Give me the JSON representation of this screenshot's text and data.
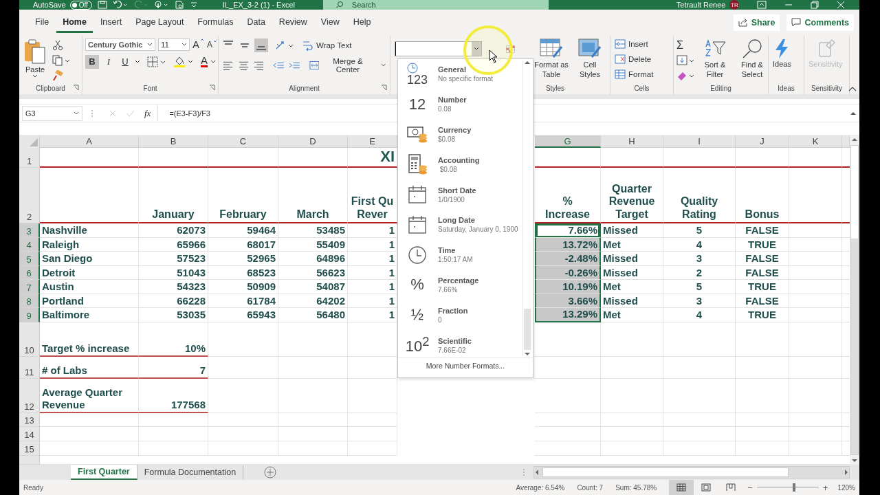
{
  "title_bar": {
    "autosave_label": "AutoSave",
    "autosave_state": "Off",
    "autosave_on": false,
    "document_title": "IL_EX_3-2 (1)  -  Excel",
    "search_placeholder": "Search",
    "user_name": "Tetrault Renee",
    "user_initials": "TR"
  },
  "menu_tabs": [
    {
      "label": "File",
      "selected": false
    },
    {
      "label": "Home",
      "selected": true
    },
    {
      "label": "Insert",
      "selected": false
    },
    {
      "label": "Page Layout",
      "selected": false
    },
    {
      "label": "Formulas",
      "selected": false
    },
    {
      "label": "Data",
      "selected": false
    },
    {
      "label": "Review",
      "selected": false
    },
    {
      "label": "View",
      "selected": false
    },
    {
      "label": "Help",
      "selected": false
    }
  ],
  "share_label": "Share",
  "comments_label": "Comments",
  "ribbon": {
    "clipboard": {
      "paste": "Paste",
      "group_label": "Clipboard"
    },
    "font": {
      "font_name": "Century Gothic",
      "font_size": "11",
      "grow_label": "A",
      "shrink_label": "A",
      "bold_label": "B",
      "italic_label": "I",
      "underline_label": "U",
      "color_label": "A",
      "bold": true,
      "italic": false,
      "underline": false,
      "group_label": "Font"
    },
    "alignment": {
      "align_top": false,
      "align_middle": false,
      "align_bottom": true,
      "wrap_text": "Wrap Text",
      "merge_center": "Merge & Center",
      "group_label": "Alignment"
    },
    "styles": {
      "format_as_table": "Format as Table",
      "cell_styles": "Cell Styles",
      "group_label": "Styles"
    },
    "cells": {
      "insert": "Insert",
      "delete": "Delete",
      "format": "Format",
      "group_label": "Cells"
    },
    "editing": {
      "sum_label": "Σ",
      "sort_filter": "Sort & Filter",
      "find_select": "Find & Select",
      "group_label": "Editing"
    },
    "ideas": {
      "button": "Ideas",
      "group_label": "Ideas"
    },
    "sensitivity": {
      "button": "Sensitivity",
      "disabled": true,
      "group_label": "Sensitivity"
    }
  },
  "formula_bar": {
    "name_box": "G3",
    "fx_label": "fx",
    "formula": "=(E3-F3)/F3"
  },
  "columns": [
    {
      "label": "A",
      "selected": false
    },
    {
      "label": "B",
      "selected": false
    },
    {
      "label": "C",
      "selected": false
    },
    {
      "label": "D",
      "selected": false
    },
    {
      "label": "E",
      "selected": false
    },
    {
      "label": "G",
      "selected": true
    },
    {
      "label": "H",
      "selected": false
    },
    {
      "label": "I",
      "selected": false
    },
    {
      "label": "J",
      "selected": false
    },
    {
      "label": "K",
      "selected": false
    }
  ],
  "rows": [
    {
      "num": "1",
      "kind": "title",
      "selected": false,
      "active": false,
      "cells": {
        "E": "XI"
      }
    },
    {
      "num": "2",
      "kind": "header",
      "selected": false,
      "active": false,
      "cells": {
        "B": "January",
        "C": "February",
        "D": "March",
        "E": [
          "First Qu",
          "Rever"
        ],
        "G": [
          "%",
          "Increase"
        ],
        "H": [
          "Quarter",
          "Revenue",
          "Target"
        ],
        "I": [
          "Quality",
          "Rating"
        ],
        "J": "Bonus"
      }
    },
    {
      "num": "3",
      "kind": "data",
      "selected": true,
      "active": true,
      "cells": {
        "A": "Nashville",
        "B": "62073",
        "C": "59464",
        "D": "53485",
        "E": "1",
        "G": "7.66%",
        "H": "Missed",
        "I": "5",
        "J": "FALSE"
      }
    },
    {
      "num": "4",
      "kind": "data",
      "selected": true,
      "active": false,
      "cells": {
        "A": "Raleigh",
        "B": "65966",
        "C": "68017",
        "D": "55409",
        "E": "1",
        "G": "13.72%",
        "H": "Met",
        "I": "4",
        "J": "TRUE"
      }
    },
    {
      "num": "5",
      "kind": "data",
      "selected": true,
      "active": false,
      "cells": {
        "A": "San Diego",
        "B": "57523",
        "C": "52965",
        "D": "64896",
        "E": "1",
        "G": "-2.48%",
        "H": "Missed",
        "I": "3",
        "J": "FALSE"
      }
    },
    {
      "num": "6",
      "kind": "data",
      "selected": true,
      "active": false,
      "cells": {
        "A": "Detroit",
        "B": "51043",
        "C": "68523",
        "D": "56623",
        "E": "1",
        "G": "-0.26%",
        "H": "Missed",
        "I": "2",
        "J": "FALSE"
      }
    },
    {
      "num": "7",
      "kind": "data",
      "selected": true,
      "active": false,
      "cells": {
        "A": "Austin",
        "B": "54323",
        "C": "50909",
        "D": "54087",
        "E": "1",
        "G": "10.19%",
        "H": "Met",
        "I": "5",
        "J": "TRUE"
      }
    },
    {
      "num": "8",
      "kind": "data",
      "selected": true,
      "active": false,
      "cells": {
        "A": "Portland",
        "B": "66228",
        "C": "61784",
        "D": "64202",
        "E": "1",
        "G": "3.66%",
        "H": "Missed",
        "I": "3",
        "J": "FALSE"
      }
    },
    {
      "num": "9",
      "kind": "data",
      "selected": true,
      "active": false,
      "cells": {
        "A": "Baltimore",
        "B": "53035",
        "C": "65943",
        "D": "56480",
        "E": "1",
        "G": "13.29%",
        "H": "Met",
        "I": "4",
        "J": "TRUE"
      }
    },
    {
      "num": "10",
      "kind": "summary",
      "selected": false,
      "active": false,
      "cells": {
        "A": "Target % increase",
        "B": "10%"
      }
    },
    {
      "num": "11",
      "kind": "summary",
      "selected": false,
      "active": false,
      "cells": {
        "A": "# of Labs",
        "B": "7"
      }
    },
    {
      "num": "12",
      "kind": "summary",
      "selected": false,
      "active": false,
      "cells": {
        "A": [
          "Average Quarter",
          "Revenue"
        ],
        "B": "177568"
      }
    },
    {
      "num": "13",
      "kind": "blank",
      "selected": false,
      "active": false,
      "cells": {}
    },
    {
      "num": "14",
      "kind": "blank",
      "selected": false,
      "active": false,
      "cells": {}
    },
    {
      "num": "15",
      "kind": "blank",
      "selected": false,
      "active": false,
      "cells": {}
    }
  ],
  "format_menu": {
    "items": [
      {
        "kind": "general",
        "glyph": "123",
        "name": "General",
        "sample": "No specific format"
      },
      {
        "kind": "glyph",
        "glyph": "12",
        "name": "Number",
        "sample": "0.08"
      },
      {
        "kind": "currency",
        "name": "Currency",
        "sample": "$0.08"
      },
      {
        "kind": "accounting",
        "name": "Accounting",
        "sample": " $0.08"
      },
      {
        "kind": "date",
        "name": "Short Date",
        "sample": "1/0/1900"
      },
      {
        "kind": "date",
        "name": "Long Date",
        "sample": "Saturday, January 0, 1900"
      },
      {
        "kind": "time",
        "name": "Time",
        "sample": "1:50:17 AM"
      },
      {
        "kind": "glyph",
        "glyph": "%",
        "name": "Percentage",
        "sample": "7.66%"
      },
      {
        "kind": "glyph",
        "glyph": "½",
        "name": "Fraction",
        "sample": "0"
      },
      {
        "kind": "glyph",
        "glyph": "10$^{2}$",
        "name": "Scientific",
        "sample": "7.66E-02"
      }
    ],
    "more_label": "More Number Formats..."
  },
  "sheet_tabs": [
    {
      "label": "First Quarter",
      "selected": true
    },
    {
      "label": "Formula Documentation",
      "selected": false
    }
  ],
  "status_bar": {
    "mode": "Ready",
    "average": "Average: 6.54%",
    "count": "Count: 7",
    "sum": "Sum: 45.78%",
    "views": [
      {
        "selected": true
      },
      {
        "selected": false
      },
      {
        "selected": false
      }
    ],
    "zoom_out_label": "−",
    "zoom_slider": {
      "level": 0.6
    },
    "zoom_in_label": "+",
    "zoom": "120%"
  }
}
